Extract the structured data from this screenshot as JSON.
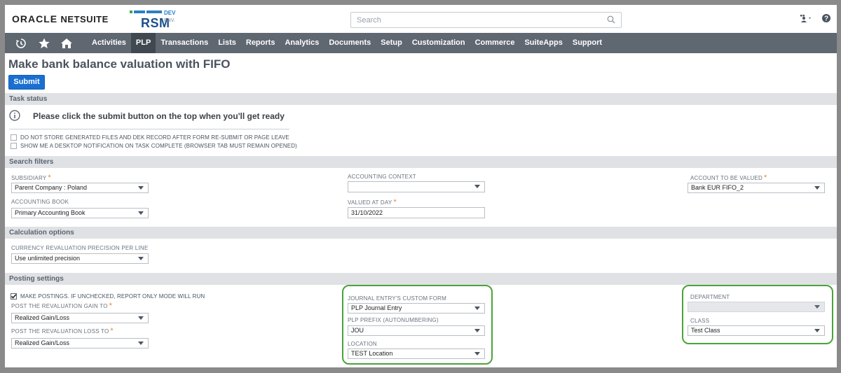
{
  "header": {
    "logo_oracle": "ORACLE",
    "logo_netsuite": "NETSUITE",
    "logo_rsm": "RSM",
    "logo_dev": "DEV",
    "logo_env": "ENV.",
    "search_placeholder": "Search",
    "icons": [
      "search-icon",
      "user-role-icon",
      "help-icon"
    ]
  },
  "nav": {
    "icons": [
      "recent-icon",
      "star-icon",
      "home-icon"
    ],
    "items": [
      {
        "label": "Activities",
        "active": false
      },
      {
        "label": "PLP",
        "active": true
      },
      {
        "label": "Transactions",
        "active": false
      },
      {
        "label": "Lists",
        "active": false
      },
      {
        "label": "Reports",
        "active": false
      },
      {
        "label": "Analytics",
        "active": false
      },
      {
        "label": "Documents",
        "active": false
      },
      {
        "label": "Setup",
        "active": false
      },
      {
        "label": "Customization",
        "active": false
      },
      {
        "label": "Commerce",
        "active": false
      },
      {
        "label": "SuiteApps",
        "active": false
      },
      {
        "label": "Support",
        "active": false
      }
    ]
  },
  "page": {
    "title": "Make bank balance valuation with FIFO",
    "submit_label": "Submit"
  },
  "task_status": {
    "section_label": "Task status",
    "info_message": "Please click the submit button on the top when you'll get ready",
    "checkbox_no_store": {
      "label": "DO NOT STORE GENERATED FILES AND DEK RECORD AFTER FORM RE-SUBMIT OR PAGE LEAVE",
      "checked": false
    },
    "checkbox_notify": {
      "label": "SHOW ME A DESKTOP NOTIFICATION ON TASK COMPLETE (BROWSER TAB MUST REMAIN OPENED)",
      "checked": false
    }
  },
  "search_filters": {
    "section_label": "Search filters",
    "subsidiary": {
      "label": "SUBSIDIARY",
      "value": "Parent Company : Poland"
    },
    "accounting_book": {
      "label": "ACCOUNTING BOOK",
      "value": "Primary Accounting Book"
    },
    "accounting_context": {
      "label": "ACCOUNTING CONTEXT",
      "value": ""
    },
    "valued_at_day": {
      "label": "VALUED AT DAY",
      "value": "31/10/2022"
    },
    "account_to_be_valued": {
      "label": "ACCOUNT TO BE VALUED",
      "value": "Bank EUR FIFO_2"
    }
  },
  "calculation_options": {
    "section_label": "Calculation options",
    "precision": {
      "label": "CURRENCY REVALUATION PRECISION PER LINE",
      "value": "Use unlimited precision"
    }
  },
  "posting_settings": {
    "section_label": "Posting settings",
    "make_postings": {
      "label": "MAKE POSTINGS. IF UNCHECKED, REPORT ONLY MODE WILL RUN",
      "checked": true
    },
    "gain_to": {
      "label": "POST THE REVALUATION GAIN TO",
      "value": "Realized Gain/Loss"
    },
    "loss_to": {
      "label": "POST THE REVALUATION LOSS TO",
      "value": "Realized Gain/Loss"
    },
    "je_custom_form": {
      "label": "JOURNAL ENTRY'S CUSTOM FORM",
      "value": "PLP Journal Entry"
    },
    "plp_prefix": {
      "label": "PLP PREFIX (AUTONUMBERING)",
      "value": "JOU"
    },
    "location": {
      "label": "LOCATION",
      "value": "TEST Location"
    },
    "department": {
      "label": "DEPARTMENT",
      "value": ""
    },
    "class": {
      "label": "CLASS",
      "value": "Test Class"
    }
  },
  "colors": {
    "nav_bg": "#5f6771",
    "nav_active": "#404850",
    "submit_blue": "#1a6fd0",
    "highlight_green": "#4aa33a",
    "required_orange": "#e08a2a"
  }
}
